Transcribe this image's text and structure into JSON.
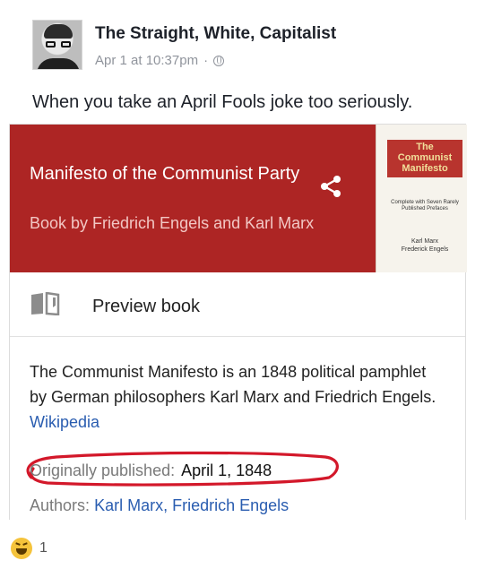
{
  "post": {
    "author": "The Straight, White, Capitalist",
    "timestamp": "Apr 1 at 10:37pm",
    "separator": "·",
    "privacy_icon": "globe-icon",
    "text": "When you take an April Fools joke too seriously."
  },
  "card": {
    "title": "Manifesto of the Communist Party",
    "subtitle": "Book by Friedrich Engels and Karl Marx",
    "share_icon": "share-icon",
    "banner_color": "#ad2524",
    "cover": {
      "title_line1": "The",
      "title_line2": "Communist",
      "title_line3": "Manifesto",
      "small_text": "Complete with Seven Rarely Published Prefaces",
      "author1": "Karl Marx",
      "author2": "Frederick Engels"
    },
    "preview_label": "Preview book",
    "preview_icon": "open-book-icon",
    "description": "The Communist Manifesto is an 1848 political pamphlet by German philosophers Karl Marx and Friedrich Engels.",
    "wiki_link": "Wikipedia",
    "published_label": "Originally published:",
    "published_value": "April 1, 1848",
    "authors_label": "Authors:",
    "authors_value": "Karl Marx, Friedrich Engels",
    "link_color": "#2a5db0",
    "highlight_color": "#d3182a"
  },
  "reactions": {
    "emoji": "laughing-emoji",
    "count": "1"
  }
}
